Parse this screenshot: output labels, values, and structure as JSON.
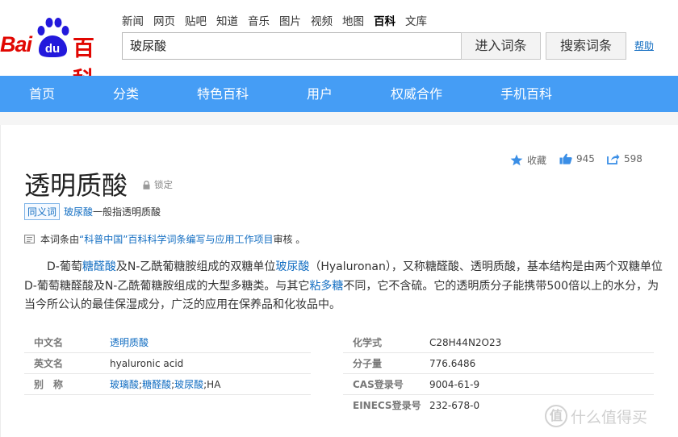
{
  "logo": {
    "part1": "Bai",
    "part2": "du",
    "part3": "百科"
  },
  "topnav": [
    "新闻",
    "网页",
    "贴吧",
    "知道",
    "音乐",
    "图片",
    "视频",
    "地图",
    "百科",
    "文库"
  ],
  "search": {
    "value": "玻尿酸",
    "enter_label": "进入词条",
    "search_label": "搜索词条",
    "help_label": "帮助"
  },
  "mainnav": [
    "首页",
    "分类",
    "特色百科",
    "用户",
    "权威合作",
    "手机百科"
  ],
  "actions": {
    "collect_label": "收藏",
    "like_count": "945",
    "share_count": "598"
  },
  "entry": {
    "title": "透明质酸",
    "lock_label": "锁定",
    "synonym_badge": "同义词",
    "synonym_word": "玻尿酸",
    "synonym_text": "一般指透明质酸",
    "review_prefix": "本词条由",
    "review_link": "“科普中国”百科科学词条编写与应用工作项目",
    "review_suffix": " 审核 。"
  },
  "paragraph": {
    "s1": "D-葡萄",
    "l1": "糖醛酸",
    "s2": "及N-乙酰葡糖胺组成的双糖单位",
    "l2": "玻尿酸",
    "s3": "（Hyaluronan），又称糖醛酸、透明质酸，基本结构是由两个双糖单位D-葡萄糖醛酸及N-乙酰葡糖胺组成的大型多糖类。与其它",
    "l3": "粘多糖",
    "s4": "不同，它不含硫。它的透明质分子能携带500倍以上的水分，为当今所公认的最佳保湿成分，广泛的应用在保养品和化妆品中。"
  },
  "infobox": {
    "left": [
      {
        "key": "中文名",
        "value": "透明质酸",
        "link": true
      },
      {
        "key": "英文名",
        "value": "hyaluronic acid",
        "link": false
      },
      {
        "key": "别　称",
        "value": "",
        "link": false
      }
    ],
    "aliases": [
      {
        "text": "玻璃酸",
        "link": true
      },
      {
        "text": ";",
        "link": false
      },
      {
        "text": "糖醛酸",
        "link": true
      },
      {
        "text": ";",
        "link": false
      },
      {
        "text": "玻尿酸",
        "link": true
      },
      {
        "text": ";HA",
        "link": false
      }
    ],
    "right": [
      {
        "key": "化学式",
        "value": "C28H44N2O23"
      },
      {
        "key": "分子量",
        "value": "776.6486"
      },
      {
        "key": "CAS登录号",
        "value": "9004-61-9"
      },
      {
        "key": "EINECS登录号",
        "value": "232-678-0"
      }
    ]
  },
  "watermark": {
    "glyph": "值",
    "text": "什么值得买"
  },
  "colors": {
    "nav_blue": "#459df5",
    "link_blue": "#136ec2",
    "brand_red": "#e10601"
  }
}
